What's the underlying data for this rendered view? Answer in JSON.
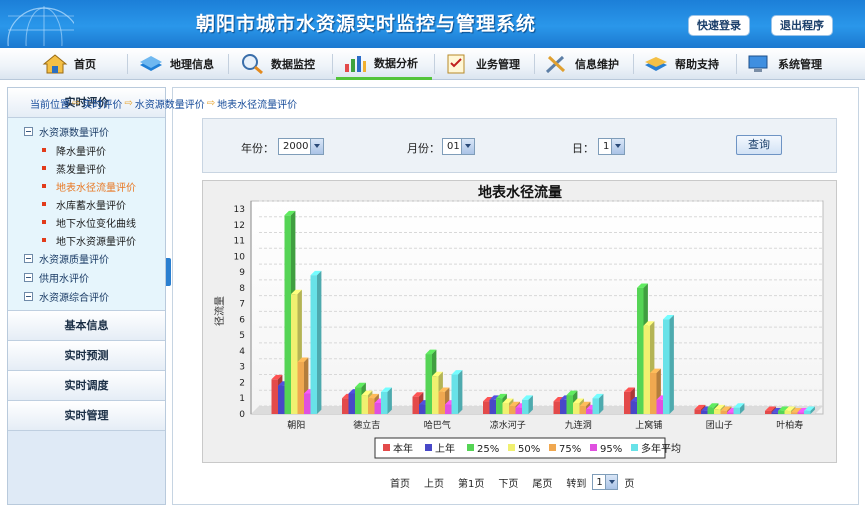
{
  "header": {
    "title": "朝阳市城市水资源实时监控与管理系统",
    "quick_login": "快速登录",
    "exit": "退出程序"
  },
  "nav": {
    "items": [
      {
        "label": "首页",
        "icon": "home-icon"
      },
      {
        "label": "地理信息",
        "icon": "map-layer-icon"
      },
      {
        "label": "数据监控",
        "icon": "magnifier-icon"
      },
      {
        "label": "数据分析",
        "icon": "bar-chart-icon"
      },
      {
        "label": "业务管理",
        "icon": "checklist-icon"
      },
      {
        "label": "信息维护",
        "icon": "tools-icon"
      },
      {
        "label": "帮助支持",
        "icon": "help-book-icon"
      },
      {
        "label": "系统管理",
        "icon": "computer-icon"
      }
    ],
    "active_index": 3
  },
  "sidebar": {
    "top_header": "实时评价",
    "groups": [
      {
        "label": "水资源数量评价",
        "children": [
          "降水量评价",
          "蒸发量评价",
          "地表水径流量评价",
          "水库蓄水量评价",
          "地下水位变化曲线",
          "地下水资源量评价"
        ]
      },
      {
        "label": "水资源质量评价",
        "children": []
      },
      {
        "label": "供用水评价",
        "children": []
      },
      {
        "label": "水资源综合评价",
        "children": []
      }
    ],
    "active_leaf": "地表水径流量评价",
    "sections": [
      "基本信息",
      "实时预测",
      "实时调度",
      "实时管理"
    ]
  },
  "breadcrumb": {
    "prefix": "当前位置",
    "items": [
      "实时评价",
      "水资源数量评价",
      "地表水径流量评价"
    ]
  },
  "filter": {
    "year_label": "年份：",
    "year_value": "2000",
    "month_label": "月份：",
    "month_value": "01",
    "day_label": "日：",
    "day_value": "1",
    "query": "查询"
  },
  "chart_data": {
    "type": "bar",
    "title": "地表水径流量",
    "ylabel": "径流量",
    "xlabel": "",
    "ylim": [
      0,
      13
    ],
    "yticks": [
      0,
      1,
      2,
      3,
      4,
      5,
      6,
      7,
      8,
      9,
      10,
      11,
      12,
      13
    ],
    "categories": [
      "朝阳",
      "德立吉",
      "哈巴气",
      "凉水河子",
      "九连洞",
      "上窝铺",
      "团山子",
      "叶柏寿"
    ],
    "series": [
      {
        "name": "本年",
        "color": "#e34a4a",
        "values": [
          2.2,
          1.0,
          1.1,
          0.8,
          0.8,
          1.4,
          0.3,
          0.2
        ]
      },
      {
        "name": "上年",
        "color": "#4848c8",
        "values": [
          1.8,
          1.3,
          0.6,
          0.9,
          0.9,
          0.8,
          0.2,
          0.1
        ]
      },
      {
        "name": "25%",
        "color": "#55d455",
        "values": [
          12.6,
          1.7,
          3.8,
          1.0,
          1.2,
          8.0,
          0.4,
          0.2
        ]
      },
      {
        "name": "50%",
        "color": "#f0f070",
        "values": [
          7.6,
          1.2,
          2.4,
          0.7,
          0.7,
          5.6,
          0.3,
          0.2
        ]
      },
      {
        "name": "75%",
        "color": "#f0a850",
        "values": [
          3.3,
          1.0,
          1.4,
          0.5,
          0.5,
          2.6,
          0.2,
          0.1
        ]
      },
      {
        "name": "95%",
        "color": "#e050e0",
        "values": [
          1.3,
          0.7,
          0.6,
          0.4,
          0.3,
          0.9,
          0.1,
          0.1
        ]
      },
      {
        "name": "多年平均",
        "color": "#68e2e8",
        "values": [
          8.8,
          1.4,
          2.5,
          0.9,
          1.0,
          6.0,
          0.4,
          0.2
        ]
      }
    ],
    "grid": true,
    "legend": "bottom"
  },
  "pager": {
    "first": "首页",
    "prev": "上页",
    "current": "第1页",
    "next": "下页",
    "last": "尾页",
    "goto": "转到",
    "goto_value": "1",
    "page_unit": "页"
  }
}
